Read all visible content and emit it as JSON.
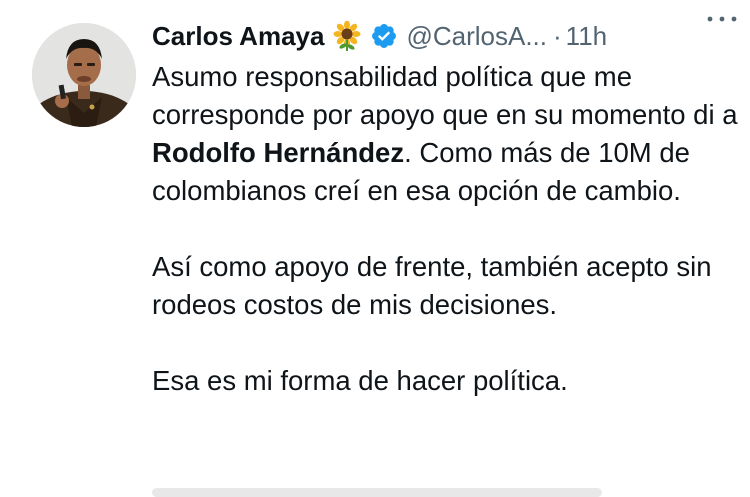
{
  "tweet": {
    "author_name": "Carlos Amaya",
    "name_emoji": "sunflower-icon",
    "verified_badge": "verified-icon",
    "handle": "@CarlosA...",
    "separator": "·",
    "time": "11h",
    "more_icon": "more-horizontal-icon",
    "paragraphs": [
      {
        "before": "Asumo responsabilidad política que me corresponde por apoyo que en su momento di a ",
        "bold": "Rodolfo Hernández",
        "after": ". Como más de 10M de colombianos creí en esa opción de cambio."
      },
      {
        "text": "Así como apoyo de frente, también acepto sin rodeos costos de mis decisiones."
      },
      {
        "text": "Esa es mi forma de hacer política."
      }
    ]
  },
  "colors": {
    "text": "#0f1419",
    "secondary": "#536471",
    "verified": "#1d9bf0",
    "background": "#ffffff"
  }
}
